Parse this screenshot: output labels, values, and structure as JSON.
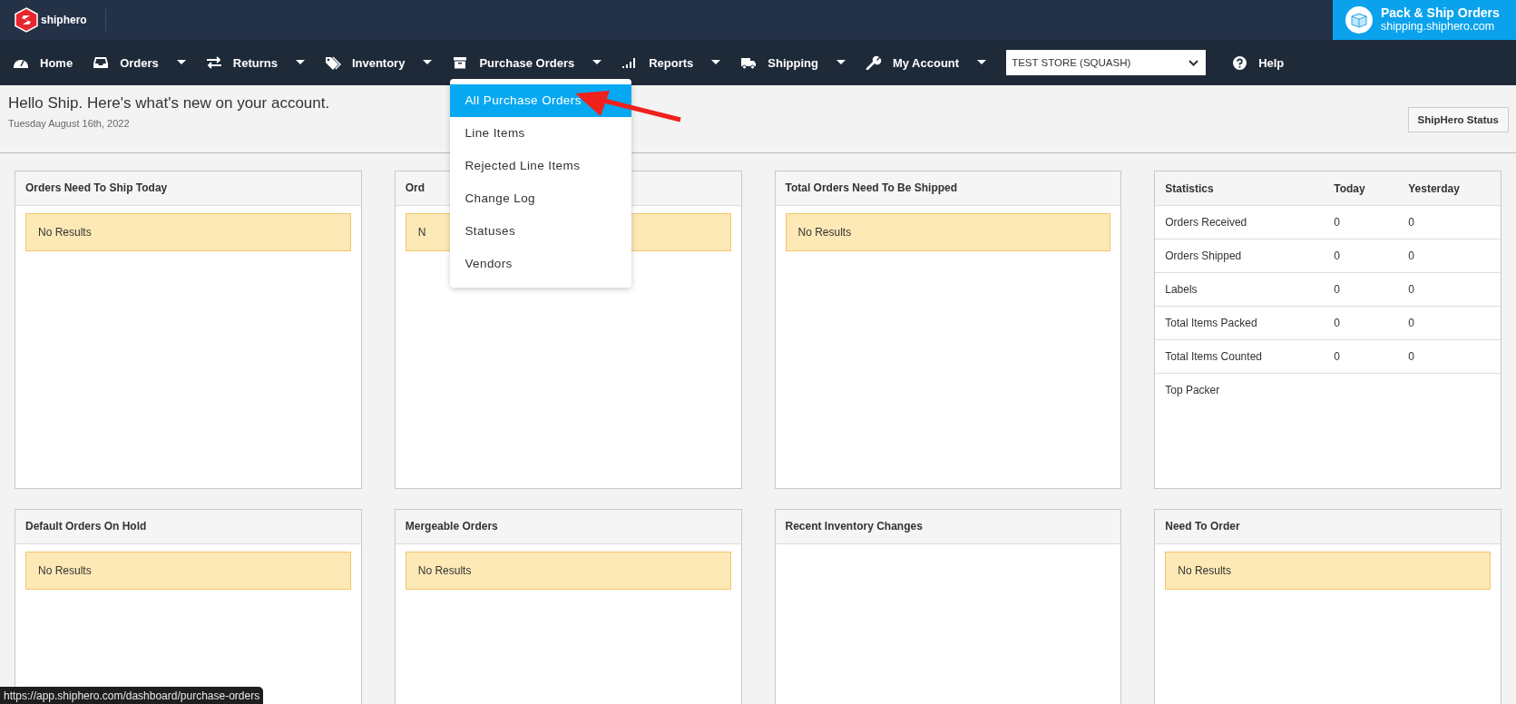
{
  "brand": {
    "name": "shiphero"
  },
  "promo": {
    "title": "Pack & Ship Orders",
    "url": "shipping.shiphero.com"
  },
  "nav": [
    {
      "label": "Home",
      "dropdown": false
    },
    {
      "label": "Orders",
      "dropdown": true
    },
    {
      "label": "Returns",
      "dropdown": true
    },
    {
      "label": "Inventory",
      "dropdown": true
    },
    {
      "label": "Purchase Orders",
      "dropdown": true
    },
    {
      "label": "Reports",
      "dropdown": true
    },
    {
      "label": "Shipping",
      "dropdown": true
    },
    {
      "label": "My Account",
      "dropdown": true
    }
  ],
  "store_select": {
    "value": "TEST STORE (SQUASH)"
  },
  "help": {
    "label": "Help"
  },
  "dropdown_menu": [
    {
      "label": "All Purchase Orders",
      "selected": true
    },
    {
      "label": "Line Items",
      "selected": false
    },
    {
      "label": "Rejected Line Items",
      "selected": false
    },
    {
      "label": "Change Log",
      "selected": false
    },
    {
      "label": "Statuses",
      "selected": false
    },
    {
      "label": "Vendors",
      "selected": false
    }
  ],
  "greeting": {
    "title": "Hello Ship. Here's what's new on your account.",
    "date": "Tuesday August 16th, 2022"
  },
  "status_button": {
    "label": "ShipHero Status"
  },
  "panels": [
    {
      "kind": "list",
      "title": "Orders Need To Ship Today",
      "message": "No Results"
    },
    {
      "kind": "list",
      "title": "Ord",
      "message": "N"
    },
    {
      "kind": "list",
      "title": "Total Orders Need To Be Shipped",
      "message": "No Results"
    },
    {
      "kind": "stats",
      "columns": [
        "Statistics",
        "Today",
        "Yesterday"
      ],
      "rows": [
        [
          "Orders Received",
          "0",
          "0"
        ],
        [
          "Orders Shipped",
          "0",
          "0"
        ],
        [
          "Labels",
          "0",
          "0"
        ],
        [
          "Total Items Packed",
          "0",
          "0"
        ],
        [
          "Total Items Counted",
          "0",
          "0"
        ],
        [
          "Top Packer"
        ]
      ]
    },
    {
      "kind": "list",
      "title": "Default Orders On Hold",
      "message": "No Results"
    },
    {
      "kind": "list",
      "title": "Mergeable Orders",
      "message": "No Results"
    },
    {
      "kind": "list",
      "title": "Recent Inventory Changes"
    },
    {
      "kind": "list",
      "title": "Need To Order",
      "message": "No Results"
    }
  ],
  "link_preview": {
    "url": "https://app.shiphero.com/dashboard/purchase-orders"
  }
}
